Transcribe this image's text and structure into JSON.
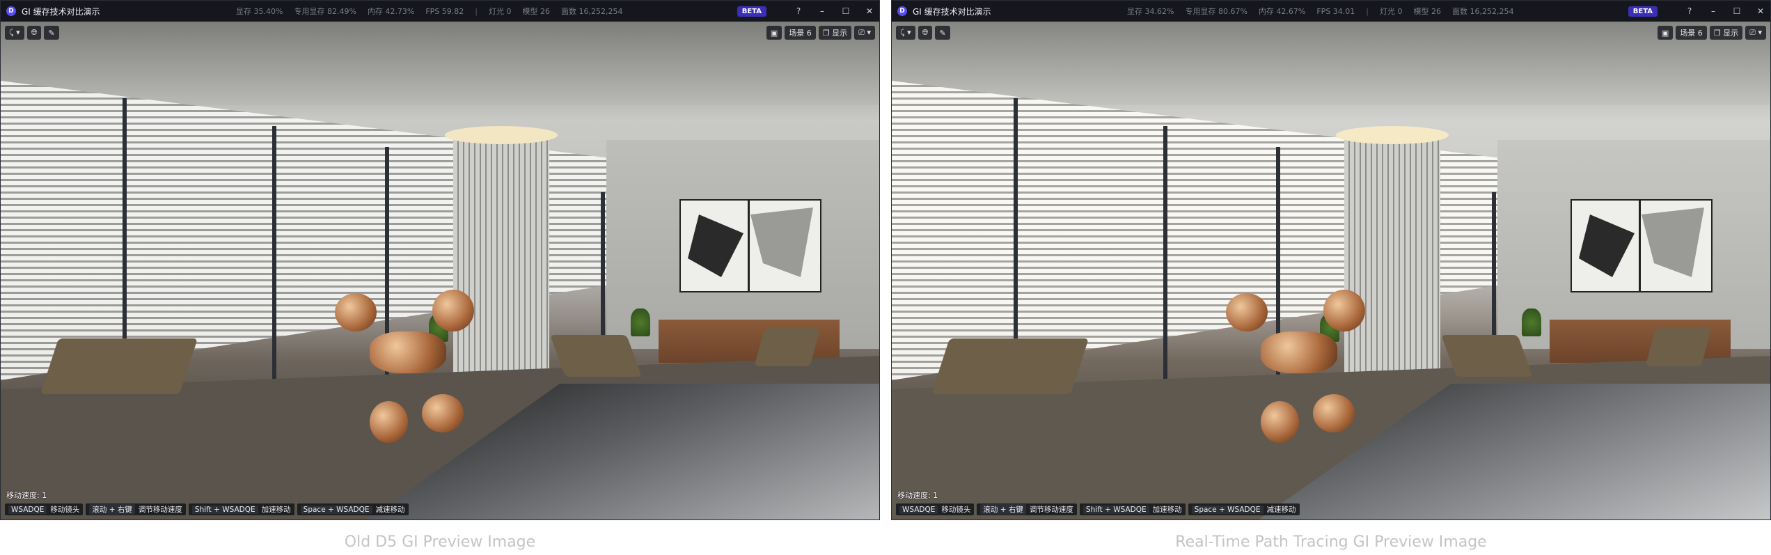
{
  "windows": [
    {
      "app_title": "GI 缓存技术对比演示",
      "stats": {
        "vram": "显存 35.40%",
        "dedicated_vram": "专用显存 82.49%",
        "memory": "内存 42.73%",
        "fps": "FPS 59.82",
        "sep": "|",
        "lights": "灯光 0",
        "models": "模型 26",
        "faces": "面数 16,252,254"
      },
      "beta": "BETA",
      "scene_label": "场景 6",
      "display_label": "显示",
      "move_speed": "移动速度: 1",
      "hints": [
        {
          "key": "WSADQE",
          "action": "移动镜头"
        },
        {
          "key": "滚动 + 右键",
          "action": "调节移动速度"
        },
        {
          "key": "Shift + WSADQE",
          "action": "加速移动"
        },
        {
          "key": "Space + WSADQE",
          "action": "减速移动"
        }
      ],
      "caption": "Old D5 GI Preview Image"
    },
    {
      "app_title": "GI 缓存技术对比演示",
      "stats": {
        "vram": "显存 34.62%",
        "dedicated_vram": "专用显存 80.67%",
        "memory": "内存 42.67%",
        "fps": "FPS 34.01",
        "sep": "|",
        "lights": "灯光 0",
        "models": "模型 26",
        "faces": "面数 16,252,254"
      },
      "beta": "BETA",
      "scene_label": "场景 6",
      "display_label": "显示",
      "move_speed": "移动速度: 1",
      "hints": [
        {
          "key": "WSADQE",
          "action": "移动镜头"
        },
        {
          "key": "滚动 + 右键",
          "action": "调节移动速度"
        },
        {
          "key": "Shift + WSADQE",
          "action": "加速移动"
        },
        {
          "key": "Space + WSADQE",
          "action": "减速移动"
        }
      ],
      "caption": "Real-Time Path Tracing GI Preview Image"
    }
  ],
  "icons": {
    "logo": "d5-logo-icon",
    "help": "help-icon",
    "minimize": "minimize-icon",
    "maximize": "maximize-icon",
    "close": "close-icon",
    "navigate": "navigate-mode-icon",
    "globe": "globe-icon",
    "eyedropper": "eyedropper-icon",
    "focus": "focus-frame-icon",
    "display": "display-icon",
    "camera": "camera-icon"
  },
  "colors": {
    "accent": "#3b2fb8",
    "titlebar": "#15171d",
    "caption": "#c4c4c4"
  }
}
